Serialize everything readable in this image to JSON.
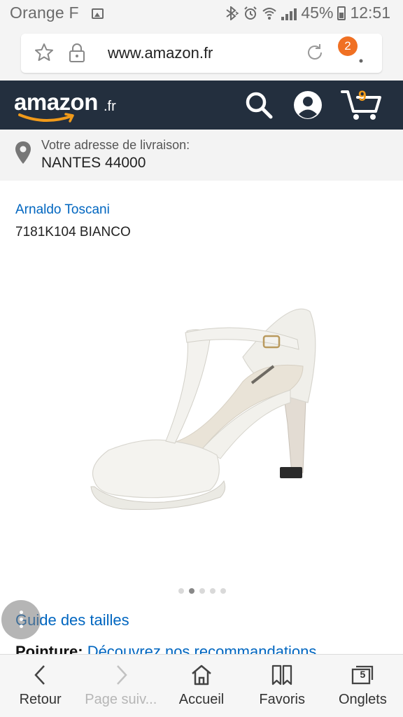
{
  "status_bar": {
    "carrier": "Orange F",
    "battery": "45%",
    "time": "12:51"
  },
  "browser": {
    "url": "www.amazon.fr",
    "notification_count": "2"
  },
  "header": {
    "logo_text": "amazon",
    "logo_tld": ".fr",
    "cart_count": "9",
    "colors": {
      "background": "#232f3e",
      "smile": "#f09a1a"
    }
  },
  "delivery": {
    "label": "Votre adresse de livraison:",
    "city": "NANTES 44000"
  },
  "product": {
    "brand": "Arnaldo Toscani",
    "title": "7181K104 BIANCO",
    "image": "white-tstrap-heel-shoe",
    "carousel": {
      "total": 5,
      "active_index": 1
    }
  },
  "links": {
    "size_guide": "Guide des tailles",
    "pointure_label": "Pointure:",
    "pointure_link": "Découvrez nos recommandations"
  },
  "bottom_nav": {
    "items": [
      {
        "label": "Retour",
        "icon": "back-icon"
      },
      {
        "label": "Page suiv...",
        "icon": "forward-icon"
      },
      {
        "label": "Accueil",
        "icon": "home-icon"
      },
      {
        "label": "Favoris",
        "icon": "bookmark-icon"
      },
      {
        "label": "Onglets",
        "icon": "tabs-icon",
        "count": "5"
      }
    ]
  }
}
